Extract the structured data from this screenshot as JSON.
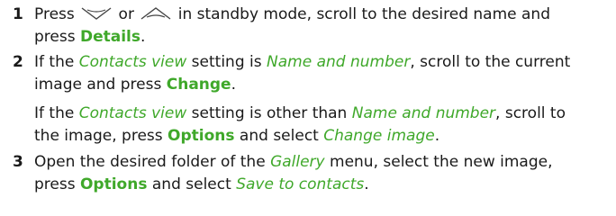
{
  "steps": [
    {
      "number": "1",
      "line1": {
        "t1": "Press ",
        "t2": " or ",
        "t3": " in standby mode, scroll to the desired name and"
      },
      "line2": {
        "t1": "press ",
        "details": "Details",
        "t2": "."
      }
    },
    {
      "number": "2",
      "line1": {
        "t1": "If the ",
        "contacts_view": "Contacts view",
        "t2": " setting is ",
        "name_and_number": "Name and number",
        "t3": ", scroll to the current"
      },
      "line2": {
        "t1": "image and press ",
        "change": "Change",
        "t2": "."
      },
      "line3": {
        "t1": "If the ",
        "contacts_view": "Contacts view",
        "t2": " setting is other than ",
        "name_and_number": "Name and number",
        "t3": ", scroll to"
      },
      "line4": {
        "t1": "the image, press ",
        "options": "Options",
        "t2": " and select ",
        "change_image": "Change image",
        "t3": "."
      }
    },
    {
      "number": "3",
      "line1": {
        "t1": "Open the desired folder of the ",
        "gallery": "Gallery",
        "t2": " menu, select the new image,"
      },
      "line2": {
        "t1": "press ",
        "options": "Options",
        "t2": " and select ",
        "save_to_contacts": "Save to contacts",
        "t3": "."
      }
    }
  ],
  "icons": {
    "down": "scroll-down-key-icon",
    "up": "scroll-up-key-icon"
  },
  "colors": {
    "accent": "#3fa82a",
    "text": "#1a1a1a"
  }
}
